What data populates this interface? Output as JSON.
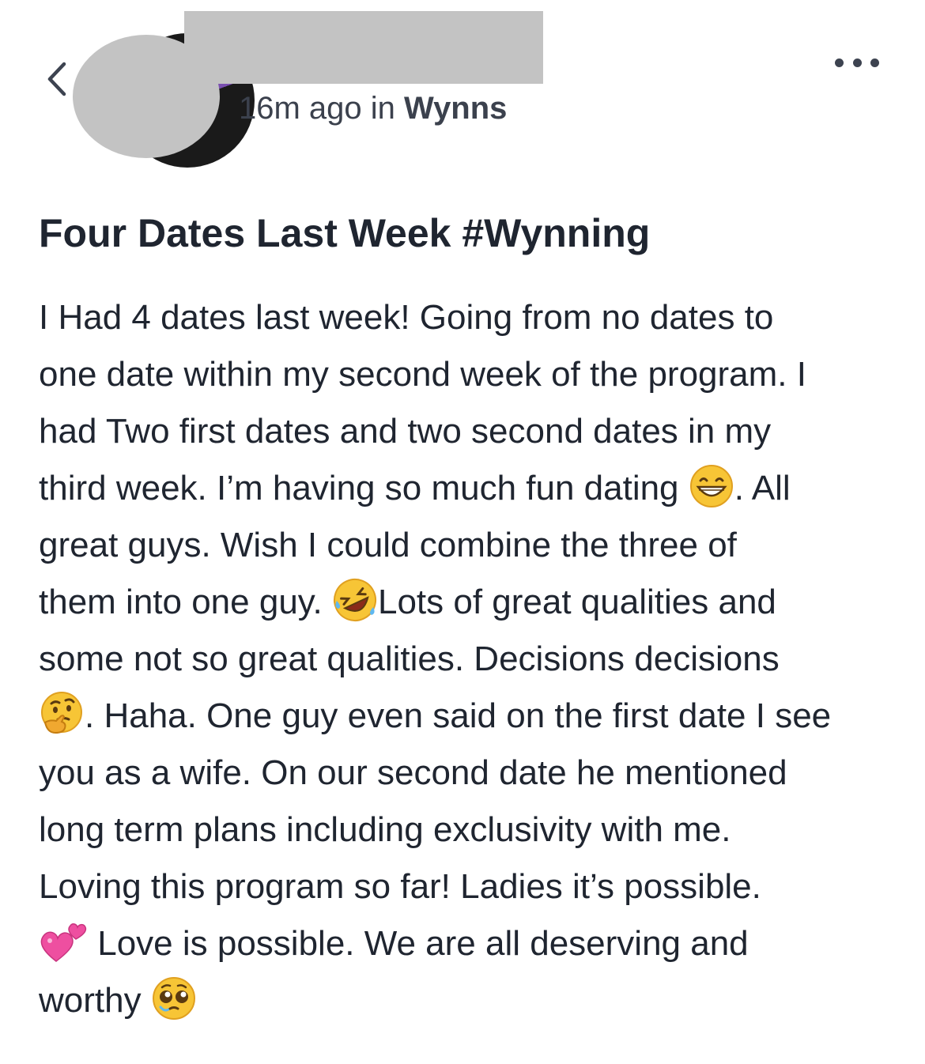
{
  "header": {
    "back_icon": "chevron-left-icon",
    "more_icon": "more-horizontal-icon",
    "time_ago": "16m ago in ",
    "group_name": "Wynns"
  },
  "post": {
    "title": "Four Dates Last Week #Wynning",
    "body_lines": [
      "I Had 4 dates last week! Going from no dates to",
      "one date within my second week of the program. I",
      "had Two first dates and two second dates in my",
      [
        "third week.  I’m having so much fun dating ",
        ". All"
      ],
      "great guys. Wish I could combine the three of",
      [
        "them into one guy. ",
        "Lots of great qualities and"
      ],
      "some not so great qualities. Decisions decisions",
      [
        "",
        ". Haha. One guy even said on the first date I see"
      ],
      "you as a wife. On our second date he mentioned",
      "long term plans including exclusivity with me.",
      "Loving this program so far! Ladies it’s possible.",
      [
        "",
        " Love is possible. We are all deserving and"
      ],
      [
        "worthy ",
        ""
      ]
    ],
    "emojis": [
      "grinning-face-emoji",
      "rofl-emoji",
      "thinking-face-emoji",
      "two-hearts-emoji",
      "pleading-face-emoji"
    ]
  }
}
